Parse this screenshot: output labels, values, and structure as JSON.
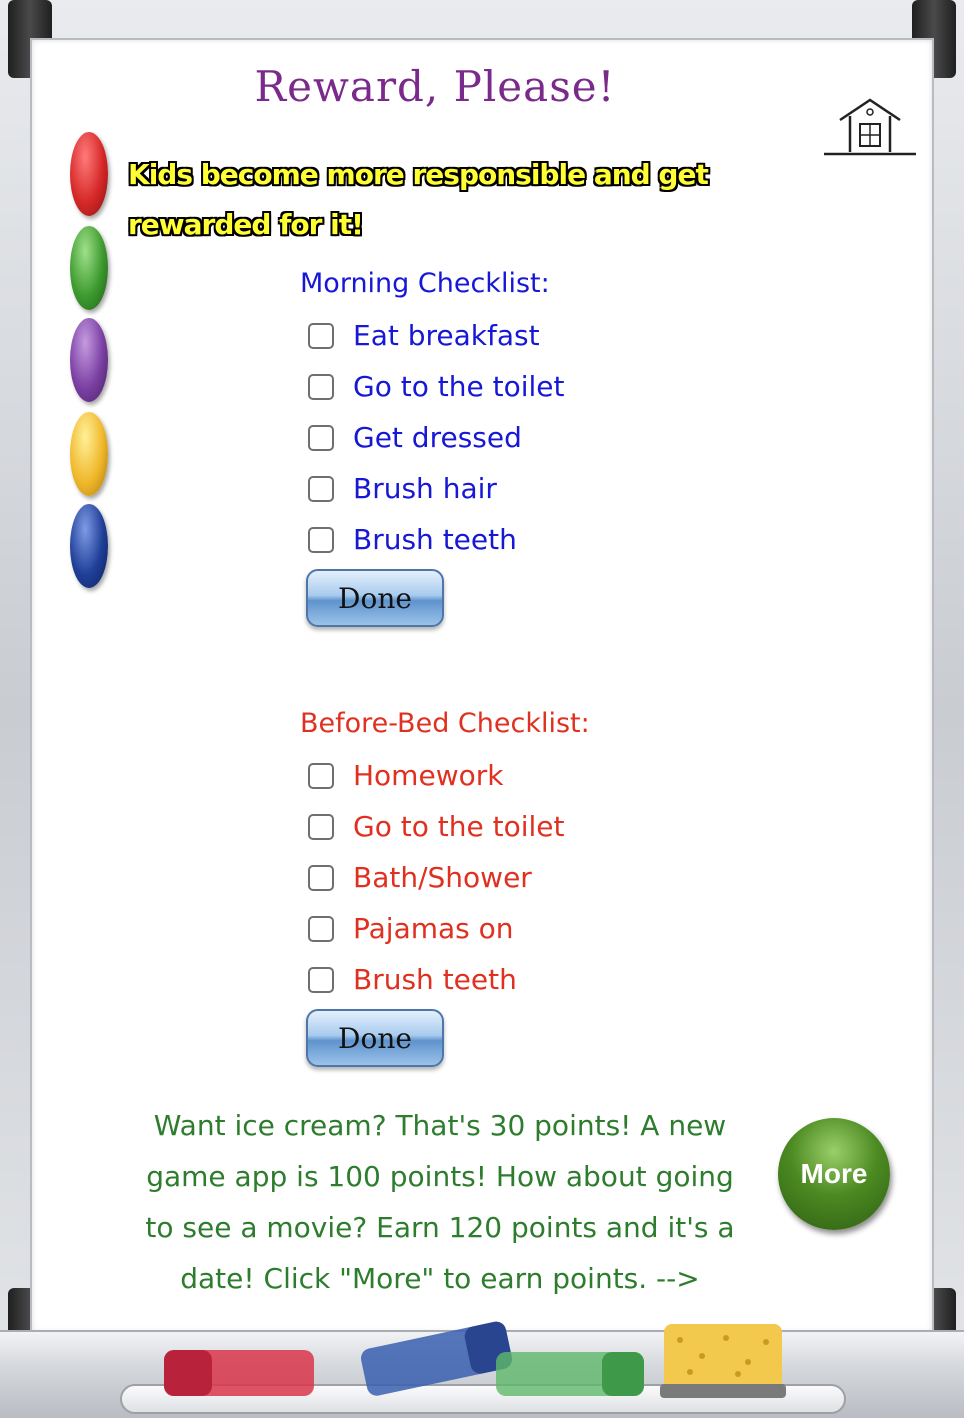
{
  "app": {
    "title": "Reward, Please!",
    "tagline": "Kids become more responsible and get rewarded for it!"
  },
  "nav": {
    "home_icon": "home-icon"
  },
  "morning": {
    "title": "Morning Checklist:",
    "color": "#1717d6",
    "items": [
      {
        "label": "Eat breakfast",
        "checked": false
      },
      {
        "label": "Go to the toilet",
        "checked": false
      },
      {
        "label": "Get dressed",
        "checked": false
      },
      {
        "label": "Brush hair",
        "checked": false
      },
      {
        "label": "Brush teeth",
        "checked": false
      }
    ],
    "done_label": "Done"
  },
  "bedtime": {
    "title": "Before-Bed Checklist:",
    "color": "#e03020",
    "items": [
      {
        "label": "Homework",
        "checked": false
      },
      {
        "label": "Go to the toilet",
        "checked": false
      },
      {
        "label": "Bath/Shower",
        "checked": false
      },
      {
        "label": "Pajamas on",
        "checked": false
      },
      {
        "label": "Brush teeth",
        "checked": false
      }
    ],
    "done_label": "Done"
  },
  "rewards": {
    "text": "Want ice cream? That's 30 points! A new game app is 100 points! How about going to see a movie? Earn 120 points and it's a date! Click \"More\" to earn points. -->",
    "more_label": "More"
  },
  "decor": {
    "magnet_colors": [
      "#d62828",
      "#3d9a2f",
      "#7b3fa3",
      "#f0b82a",
      "#1f3f98"
    ],
    "marker_colors": [
      "#d9354a",
      "#3a5fb0",
      "#5fb86a"
    ],
    "sponge_color": "#f2c94c"
  }
}
